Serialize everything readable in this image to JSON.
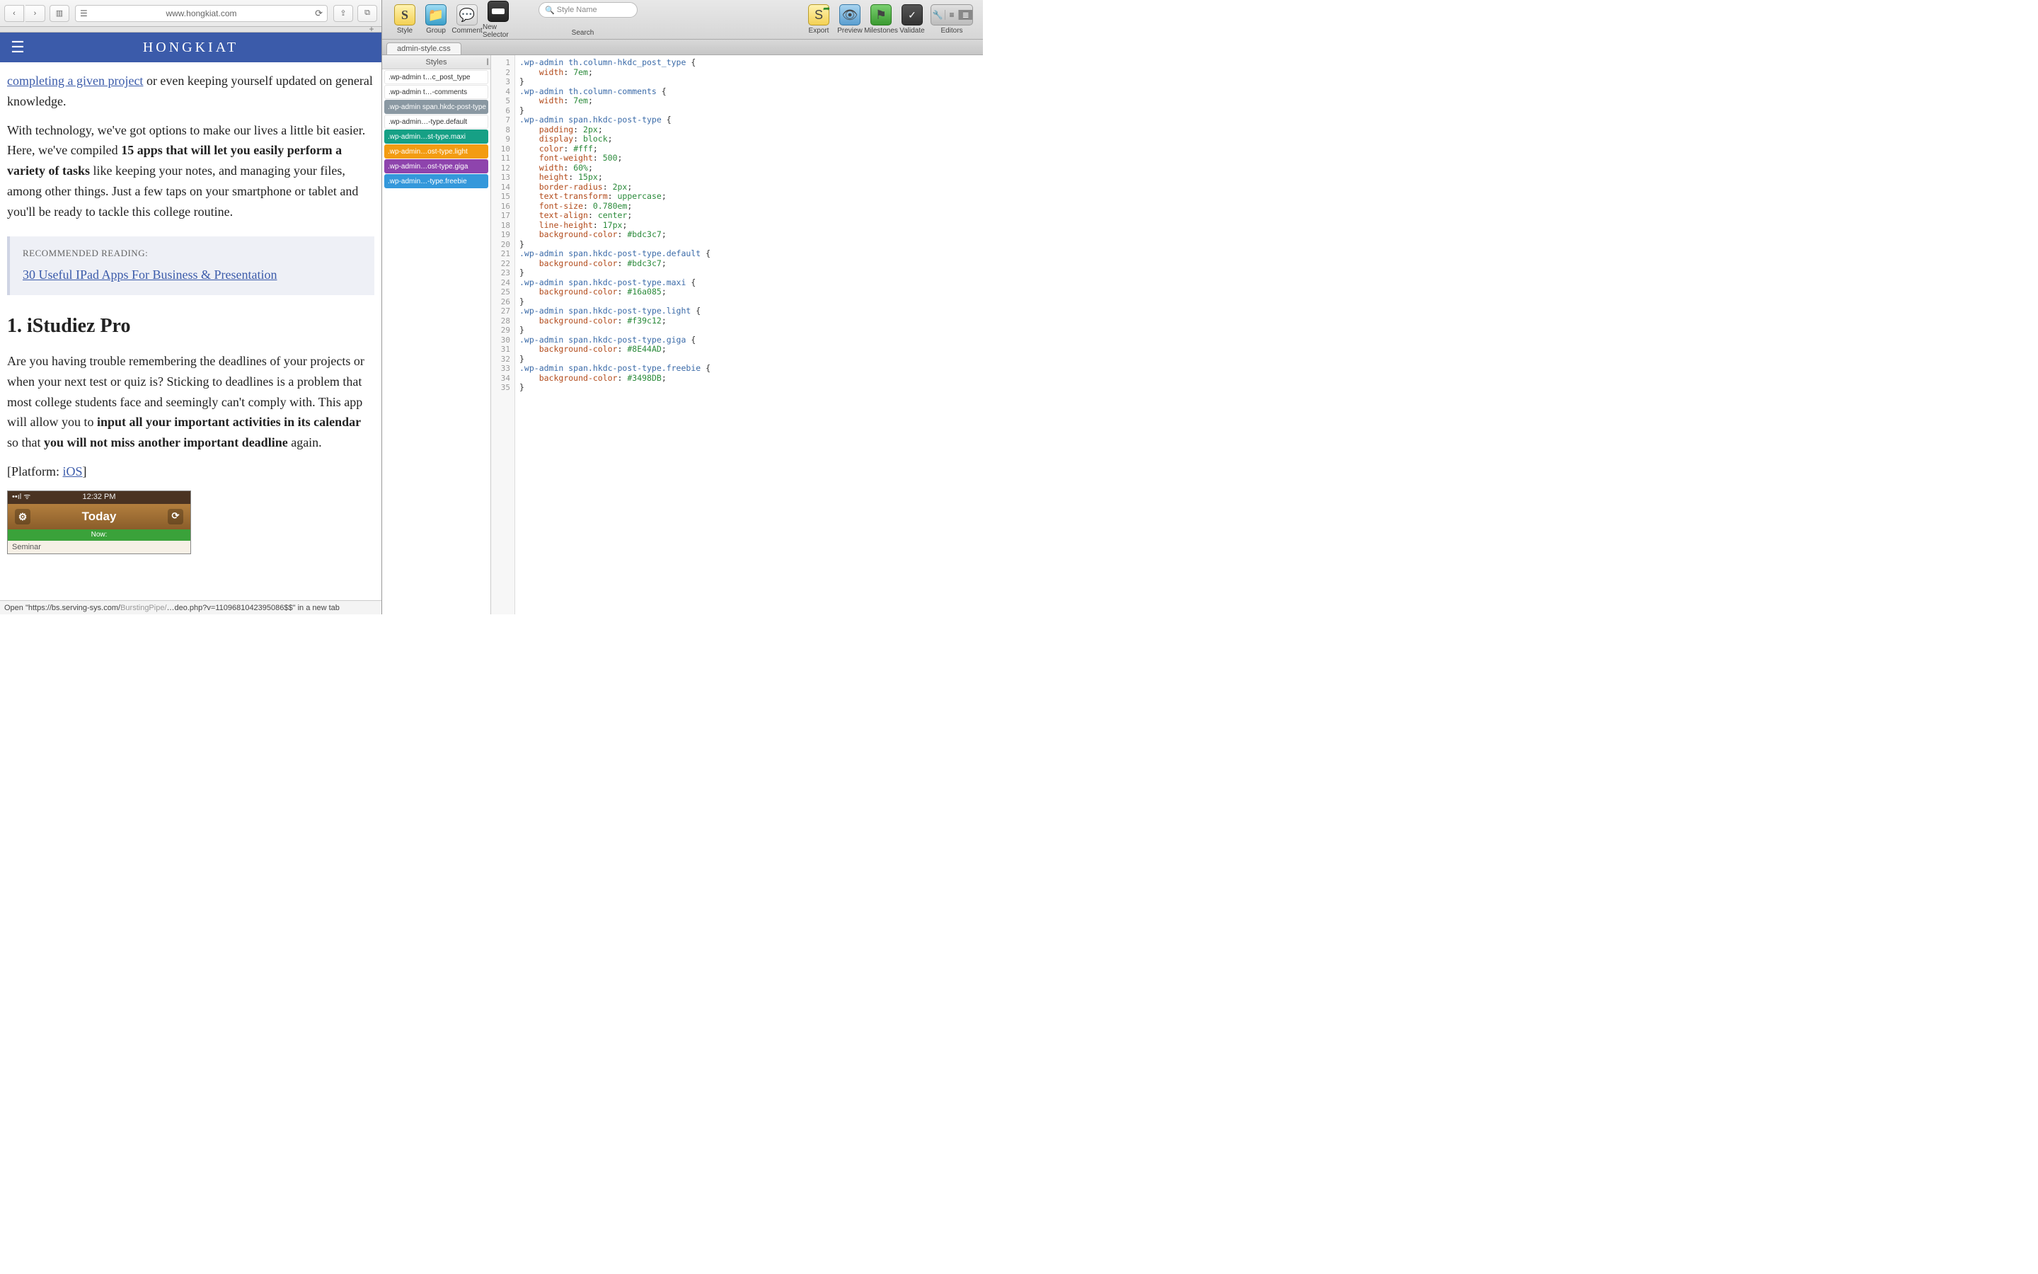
{
  "safari": {
    "url": "www.hongkiat.com",
    "newtab": "+",
    "logo": "HONGKIAT",
    "content": {
      "intro_link": "completing a given project",
      "intro_rest": " or even keeping yourself updated on general knowledge.",
      "para2_a": "With technology, we've got options to make our lives a little bit easier. Here, we've compiled ",
      "para2_b": "15 apps that will let you easily perform a variety of tasks",
      "para2_c": " like keeping your notes, and managing your files, among other things. Just a few taps on your smartphone or tablet and you'll be ready to tackle this college routine.",
      "rec_title": "RECOMMENDED READING:",
      "rec_link": "30 Useful IPad Apps For Business & Presentation",
      "h2": "1. iStudiez Pro",
      "p3_a": "Are you having trouble remembering the deadlines of your projects or when your next test or quiz is? Sticking to deadlines is a problem that most college students face and seemingly can't comply with. This app will allow you to ",
      "p3_b": "input all your important activities in its calendar",
      "p3_c": " so that ",
      "p3_d": "you will not miss another important deadline",
      "p3_e": " again.",
      "platform_a": "[Platform: ",
      "platform_link": "iOS",
      "platform_b": "]",
      "app_time": "12:32 PM",
      "app_today": "Today",
      "app_now": "Now:",
      "app_seminar": "Seminar"
    },
    "status_a": "Open \"https://bs.serving-sys.com/",
    "status_b": "BurstingPipe/",
    "status_c": "…deo.php?v=1109681042395086$$\" in a new tab"
  },
  "editor": {
    "tools": {
      "style": "Style",
      "group": "Group",
      "comment": "Comment",
      "newsel": "New Selector",
      "search_ph": "Style Name",
      "search_label": "Search",
      "export": "Export",
      "preview": "Preview",
      "milestones": "Milestones",
      "validate": "Validate",
      "editors": "Editors"
    },
    "tab": "admin-style.css",
    "styles_head": "Styles",
    "style_items": [
      {
        "text": ".wp-admin t…c_post_type",
        "bg": "plain"
      },
      {
        "text": ".wp-admin t…-comments",
        "bg": "plain"
      },
      {
        "text": ".wp-admin span.hkdc-post-type",
        "bg": "#8a98a2"
      },
      {
        "text": ".wp-admin…-type.default",
        "bg": "plain"
      },
      {
        "text": ".wp-admin…st-type.maxi",
        "bg": "#16a085"
      },
      {
        "text": ".wp-admin…ost-type.light",
        "bg": "#f39c12"
      },
      {
        "text": ".wp-admin…ost-type.giga",
        "bg": "#8E44AD"
      },
      {
        "text": ".wp-admin…-type.freebie",
        "bg": "#3498DB"
      }
    ],
    "code": [
      {
        "n": 1,
        "t": [
          [
            "sel",
            ".wp-admin th.column-hkdc_post_type"
          ],
          [
            "brace",
            " {"
          ]
        ]
      },
      {
        "n": 2,
        "t": [
          [
            "",
            "    "
          ],
          [
            "prop",
            "width"
          ],
          [
            "",
            ": "
          ],
          [
            "num",
            "7em"
          ],
          [
            "",
            ";"
          ]
        ]
      },
      {
        "n": 3,
        "t": [
          [
            "brace",
            "}"
          ]
        ]
      },
      {
        "n": 4,
        "t": [
          [
            "sel",
            ".wp-admin th.column-comments"
          ],
          [
            "brace",
            " {"
          ]
        ]
      },
      {
        "n": 5,
        "t": [
          [
            "",
            "    "
          ],
          [
            "prop",
            "width"
          ],
          [
            "",
            ": "
          ],
          [
            "num",
            "7em"
          ],
          [
            "",
            ";"
          ]
        ]
      },
      {
        "n": 6,
        "t": [
          [
            "brace",
            "}"
          ]
        ]
      },
      {
        "n": 7,
        "t": [
          [
            "sel",
            ".wp-admin span.hkdc-post-type"
          ],
          [
            "brace",
            " {"
          ]
        ]
      },
      {
        "n": 8,
        "t": [
          [
            "",
            "    "
          ],
          [
            "prop",
            "padding"
          ],
          [
            "",
            ": "
          ],
          [
            "num",
            "2px"
          ],
          [
            "",
            ";"
          ]
        ]
      },
      {
        "n": 9,
        "t": [
          [
            "",
            "    "
          ],
          [
            "prop",
            "display"
          ],
          [
            "",
            ": "
          ],
          [
            "num",
            "block"
          ],
          [
            "",
            ";"
          ]
        ]
      },
      {
        "n": 10,
        "t": [
          [
            "",
            "    "
          ],
          [
            "prop",
            "color"
          ],
          [
            "",
            ": "
          ],
          [
            "str",
            "#fff"
          ],
          [
            "",
            ";"
          ]
        ]
      },
      {
        "n": 11,
        "t": [
          [
            "",
            "    "
          ],
          [
            "prop",
            "font-weight"
          ],
          [
            "",
            ": "
          ],
          [
            "num",
            "500"
          ],
          [
            "",
            ";"
          ]
        ]
      },
      {
        "n": 12,
        "t": [
          [
            "",
            "    "
          ],
          [
            "prop",
            "width"
          ],
          [
            "",
            ": "
          ],
          [
            "num",
            "60%"
          ],
          [
            "",
            ";"
          ]
        ]
      },
      {
        "n": 13,
        "t": [
          [
            "",
            "    "
          ],
          [
            "prop",
            "height"
          ],
          [
            "",
            ": "
          ],
          [
            "num",
            "15px"
          ],
          [
            "",
            ";"
          ]
        ]
      },
      {
        "n": 14,
        "t": [
          [
            "",
            "    "
          ],
          [
            "prop",
            "border-radius"
          ],
          [
            "",
            ": "
          ],
          [
            "num",
            "2px"
          ],
          [
            "",
            ";"
          ]
        ]
      },
      {
        "n": 15,
        "t": [
          [
            "",
            "    "
          ],
          [
            "prop",
            "text-transform"
          ],
          [
            "",
            ": "
          ],
          [
            "num",
            "uppercase"
          ],
          [
            "",
            ";"
          ]
        ]
      },
      {
        "n": 16,
        "t": [
          [
            "",
            "    "
          ],
          [
            "prop",
            "font-size"
          ],
          [
            "",
            ": "
          ],
          [
            "num",
            "0.780em"
          ],
          [
            "",
            ";"
          ]
        ]
      },
      {
        "n": 17,
        "t": [
          [
            "",
            "    "
          ],
          [
            "prop",
            "text-align"
          ],
          [
            "",
            ": "
          ],
          [
            "num",
            "center"
          ],
          [
            "",
            ";"
          ]
        ]
      },
      {
        "n": 18,
        "t": [
          [
            "",
            "    "
          ],
          [
            "prop",
            "line-height"
          ],
          [
            "",
            ": "
          ],
          [
            "num",
            "17px"
          ],
          [
            "",
            ";"
          ]
        ]
      },
      {
        "n": 19,
        "t": [
          [
            "",
            "    "
          ],
          [
            "prop",
            "background-color"
          ],
          [
            "",
            ": "
          ],
          [
            "str",
            "#bdc3c7"
          ],
          [
            "",
            ";"
          ]
        ]
      },
      {
        "n": 20,
        "t": [
          [
            "brace",
            "}"
          ]
        ]
      },
      {
        "n": 21,
        "t": [
          [
            "sel",
            ".wp-admin span.hkdc-post-type.default"
          ],
          [
            "brace",
            " {"
          ]
        ]
      },
      {
        "n": 22,
        "t": [
          [
            "",
            "    "
          ],
          [
            "prop",
            "background-color"
          ],
          [
            "",
            ": "
          ],
          [
            "str",
            "#bdc3c7"
          ],
          [
            "",
            ";"
          ]
        ]
      },
      {
        "n": 23,
        "t": [
          [
            "brace",
            "}"
          ]
        ]
      },
      {
        "n": 24,
        "t": [
          [
            "sel",
            ".wp-admin span.hkdc-post-type.maxi"
          ],
          [
            "brace",
            " {"
          ]
        ]
      },
      {
        "n": 25,
        "t": [
          [
            "",
            "    "
          ],
          [
            "prop",
            "background-color"
          ],
          [
            "",
            ": "
          ],
          [
            "str",
            "#16a085"
          ],
          [
            "",
            ";"
          ]
        ]
      },
      {
        "n": 26,
        "t": [
          [
            "brace",
            "}"
          ]
        ]
      },
      {
        "n": 27,
        "t": [
          [
            "sel",
            ".wp-admin span.hkdc-post-type.light"
          ],
          [
            "brace",
            " {"
          ]
        ]
      },
      {
        "n": 28,
        "t": [
          [
            "",
            "    "
          ],
          [
            "prop",
            "background-color"
          ],
          [
            "",
            ": "
          ],
          [
            "str",
            "#f39c12"
          ],
          [
            "",
            ";"
          ]
        ]
      },
      {
        "n": 29,
        "t": [
          [
            "brace",
            "}"
          ]
        ]
      },
      {
        "n": 30,
        "t": [
          [
            "sel",
            ".wp-admin span.hkdc-post-type.giga"
          ],
          [
            "brace",
            " {"
          ]
        ]
      },
      {
        "n": 31,
        "t": [
          [
            "",
            "    "
          ],
          [
            "prop",
            "background-color"
          ],
          [
            "",
            ": "
          ],
          [
            "str",
            "#8E44AD"
          ],
          [
            "",
            ";"
          ]
        ]
      },
      {
        "n": 32,
        "t": [
          [
            "brace",
            "}"
          ]
        ]
      },
      {
        "n": 33,
        "t": [
          [
            "sel",
            ".wp-admin span.hkdc-post-type.freebie"
          ],
          [
            "brace",
            " {"
          ]
        ]
      },
      {
        "n": 34,
        "t": [
          [
            "",
            "    "
          ],
          [
            "prop",
            "background-color"
          ],
          [
            "",
            ": "
          ],
          [
            "str",
            "#3498DB"
          ],
          [
            "",
            ";"
          ]
        ]
      },
      {
        "n": 35,
        "t": [
          [
            "brace",
            "}"
          ]
        ]
      }
    ]
  }
}
